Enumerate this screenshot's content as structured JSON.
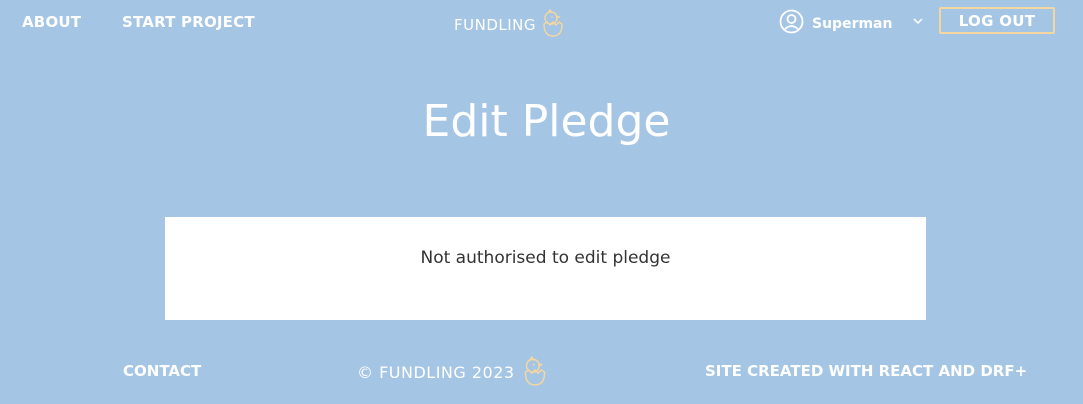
{
  "header": {
    "nav": {
      "about": "ABOUT",
      "start_project": "START PROJECT"
    },
    "brand": {
      "name": "FUNDLING",
      "logo_icon": "chick-egg-icon"
    },
    "user": {
      "icon": "user-circle-icon",
      "name": "Superman",
      "menu_icon": "chevron-down-icon"
    },
    "logout_label": "LOG OUT"
  },
  "main": {
    "title": "Edit Pledge",
    "message": "Not authorised to edit pledge"
  },
  "footer": {
    "contact": "CONTACT",
    "copyright": "© FUNDLING 2023",
    "logo_icon": "chick-egg-icon",
    "credit": "SITE CREATED WITH REACT AND DRF+"
  },
  "colors": {
    "background": "#a5c5e4",
    "text": "#ffffff",
    "accent": "#f5d6a0",
    "card": "#ffffff",
    "card_text": "#333333"
  }
}
